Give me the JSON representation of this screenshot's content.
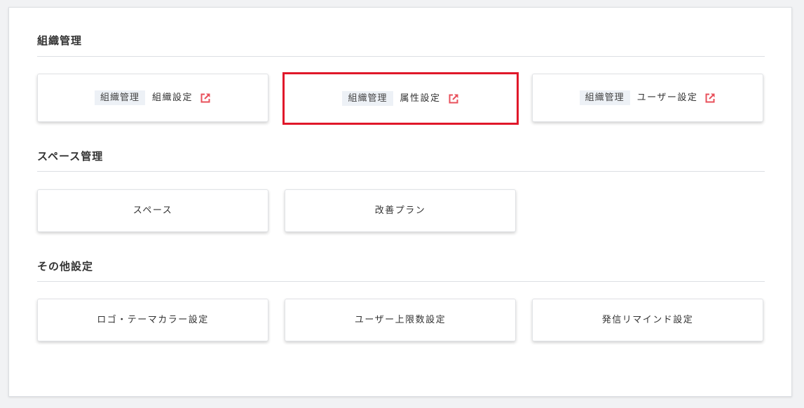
{
  "sections": [
    {
      "title": "組織管理",
      "cards": [
        {
          "tag": "組織管理",
          "label": "組織設定",
          "icon": "external-link-icon"
        },
        {
          "tag": "組織管理",
          "label": "属性設定",
          "icon": "external-link-icon"
        },
        {
          "tag": "組織管理",
          "label": "ユーザー設定",
          "icon": "external-link-icon"
        }
      ]
    },
    {
      "title": "スペース管理",
      "cards": [
        {
          "label": "スペース"
        },
        {
          "label": "改善プラン"
        }
      ]
    },
    {
      "title": "その他設定",
      "cards": [
        {
          "label": "ロゴ・テーマカラー設定"
        },
        {
          "label": "ユーザー上限数設定"
        },
        {
          "label": "発信リマインド設定"
        }
      ]
    }
  ],
  "colors": {
    "icon_accent": "#e8505b",
    "highlight_border": "#e0182a",
    "tag_background": "#edf1f6"
  }
}
